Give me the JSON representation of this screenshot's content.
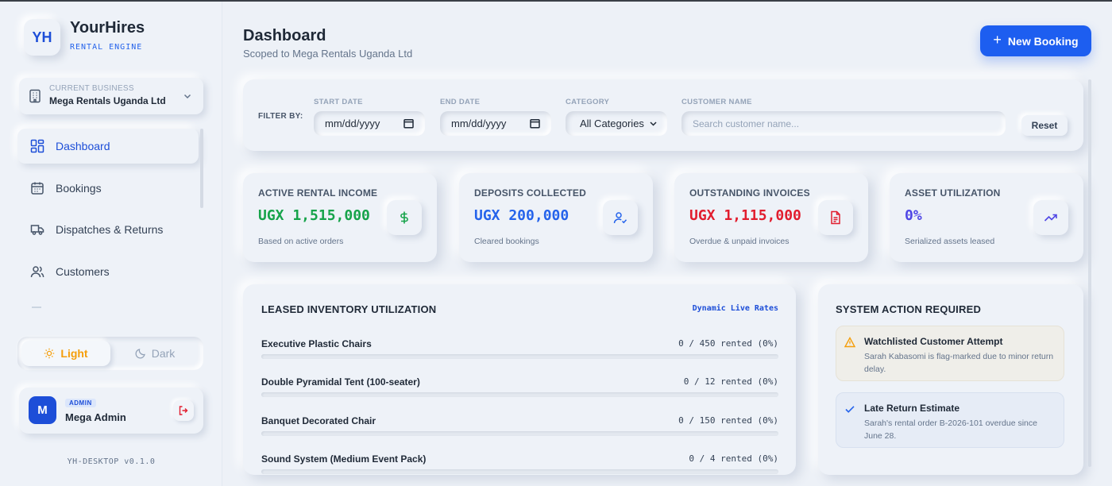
{
  "brand": {
    "initials": "YH",
    "name": "YourHires",
    "subtitle": "RENTAL ENGINE"
  },
  "business": {
    "label": "CURRENT BUSINESS",
    "value": "Mega Rentals Uganda Ltd"
  },
  "nav": [
    {
      "label": "Dashboard",
      "icon": "dashboard-grid-icon",
      "active": true
    },
    {
      "label": "Bookings",
      "icon": "calendar-icon",
      "active": false
    },
    {
      "label": "Dispatches & Returns",
      "icon": "truck-icon",
      "active": false
    },
    {
      "label": "Customers",
      "icon": "users-icon",
      "active": false
    }
  ],
  "theme": {
    "light": "Light",
    "dark": "Dark",
    "selected": "Light"
  },
  "user": {
    "initial": "M",
    "role": "ADMIN",
    "name": "Mega Admin"
  },
  "version": "YH-DESKTOP v0.1.0",
  "header": {
    "title": "Dashboard",
    "subtitle": "Scoped to Mega Rentals Uganda Ltd",
    "new_booking": "New Booking"
  },
  "filters": {
    "filter_by": "FILTER BY:",
    "start_date_label": "START DATE",
    "start_date_value": "mm/dd/yyyy",
    "end_date_label": "END DATE",
    "end_date_value": "mm/dd/yyyy",
    "category_label": "CATEGORY",
    "category_value": "All Categories",
    "customer_label": "CUSTOMER NAME",
    "customer_placeholder": "Search customer name...",
    "reset": "Reset"
  },
  "stats": [
    {
      "label": "ACTIVE RENTAL INCOME",
      "value": "UGX 1,515,000",
      "note": "Based on active orders",
      "color": "#16a34a",
      "icon": "dollar-icon"
    },
    {
      "label": "DEPOSITS COLLECTED",
      "value": "UGX 200,000",
      "note": "Cleared bookings",
      "color": "#2563eb",
      "icon": "user-check-icon"
    },
    {
      "label": "OUTSTANDING INVOICES",
      "value": "UGX 1,115,000",
      "note": "Overdue & unpaid invoices",
      "color": "#e11d2e",
      "icon": "invoice-icon"
    },
    {
      "label": "ASSET UTILIZATION",
      "value": "0%",
      "note": "Serialized assets leased",
      "color": "#4f46e5",
      "icon": "trending-up-icon"
    }
  ],
  "inventory": {
    "title": "LEASED INVENTORY UTILIZATION",
    "tag": "Dynamic Live Rates",
    "items": [
      {
        "name": "Executive Plastic Chairs",
        "count": "0 / 450 rented (0%)",
        "fraction": 0
      },
      {
        "name": "Double Pyramidal Tent (100-seater)",
        "count": "0 / 12 rented (0%)",
        "fraction": 0
      },
      {
        "name": "Banquet Decorated Chair",
        "count": "0 / 150 rented (0%)",
        "fraction": 0
      },
      {
        "name": "Sound System (Medium Event Pack)",
        "count": "0 / 4 rented (0%)",
        "fraction": 0
      }
    ]
  },
  "system": {
    "title": "SYSTEM ACTION REQUIRED",
    "alerts": [
      {
        "title": "Watchlisted Customer Attempt",
        "text": "Sarah Kabasomi is flag-marked due to minor return delay.",
        "icon": "warning-triangle-icon",
        "color": "#f59e0b"
      },
      {
        "title": "Late Return Estimate",
        "text": "Sarah's rental order B-2026-101 overdue since June 28.",
        "icon": "check-icon",
        "color": "#2563eb"
      }
    ]
  }
}
